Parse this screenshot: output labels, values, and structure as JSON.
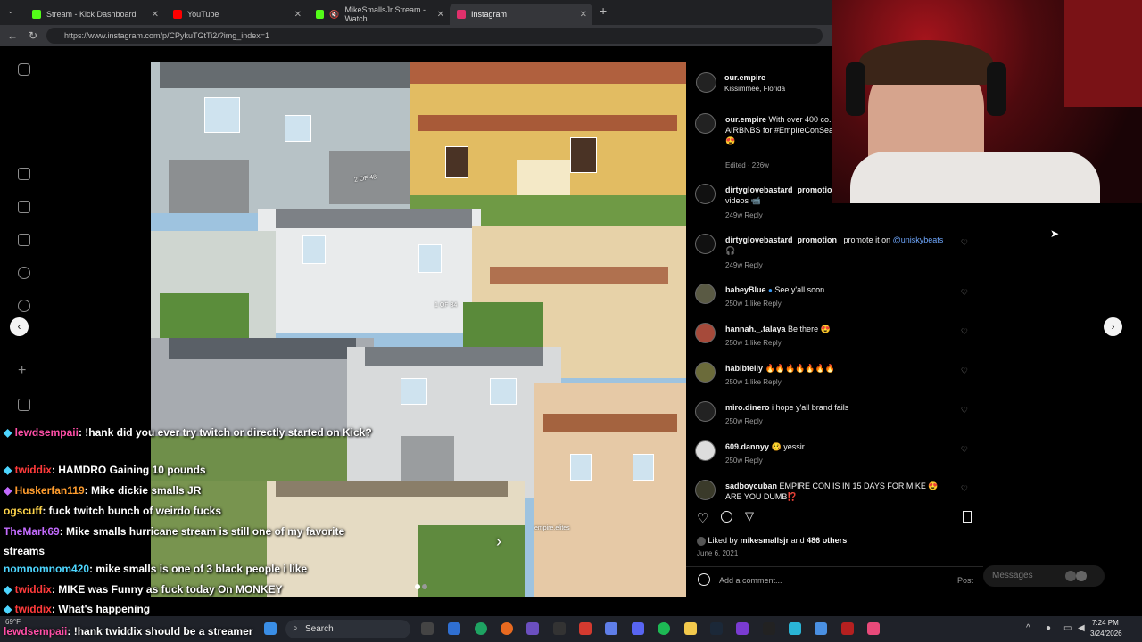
{
  "browser": {
    "tabs": [
      {
        "label": "Stream - Kick Dashboard",
        "color": "#53fc18"
      },
      {
        "label": "YouTube",
        "color": "#ff0000"
      },
      {
        "label": "MikeSmallsJr Stream - Watch",
        "color": "#53fc18"
      },
      {
        "label": "Instagram",
        "color": "#e1306c"
      }
    ],
    "url": "https://www.instagram.com/p/CPykuTGtTi2/?img_index=1"
  },
  "post": {
    "image_labels": {
      "a": "2 OF 48",
      "b": "1 OF 34",
      "c": "empire.elites"
    },
    "author": "our.empire",
    "location": "Kissimmee, Florida",
    "caption": {
      "user": "our.empire",
      "text": "With over 400 co... counting...the Our.Empire co... AIRBNBS for #EmpireConSea... showtime! Who's excited?! 😍",
      "meta": "Edited · 226w"
    },
    "comments": [
      {
        "user": "dirtyglovebastard_promotion",
        "text": "videos 📹",
        "meta": "249w   Reply"
      },
      {
        "user": "dirtyglovebastard_promotion_",
        "text": "promote it on",
        "link": "@uniskybeats",
        "extra": "🎧",
        "meta": "249w   Reply"
      },
      {
        "user": "babeyBlue",
        "text": "See y'all soon",
        "meta": "250w   1 like   Reply"
      },
      {
        "user": "hannah._.talaya",
        "text": "Be there 😍",
        "meta": "250w   1 like   Reply"
      },
      {
        "user": "habibtelly",
        "text": "🔥🔥🔥🔥🔥🔥🔥",
        "meta": "250w   1 like   Reply"
      },
      {
        "user": "miro.dinero",
        "text": "i hope y'all brand fails",
        "meta": "250w   Reply"
      },
      {
        "user": "609.dannyy",
        "text": "🥴 yessir",
        "meta": "250w   Reply"
      },
      {
        "user": "sadboycuban",
        "text": "EMPIRE CON IS IN 15 DAYS FOR MIKE 😍 ARE YOU DUMB⁉️",
        "meta": ""
      }
    ],
    "likes": {
      "prefix": "Liked by",
      "user": "mikesmallsjr",
      "and": "and",
      "count": "486 others"
    },
    "date": "June 6, 2021",
    "add_comment_placeholder": "Add a comment...",
    "post_label": "Post"
  },
  "messages_label": "Messages",
  "chat": [
    {
      "user": "lewdsempaii",
      "color": "#ff4fa7",
      "msg": ": !hank did you ever try twitch or directly started on Kick?"
    },
    {
      "user": "twiddix",
      "color": "#ff3b3b",
      "msg": ": HAMDRO Gaining 10 pounds"
    },
    {
      "user": "Huskerfan119",
      "color": "#ff9d2e",
      "msg": ": Mike dickie smalls JR"
    },
    {
      "user": "ogscuff",
      "color": "#ffd54a",
      "msg": ": fuck twitch bunch of weirdo fucks"
    },
    {
      "user": "TheMark69",
      "color": "#c46bff",
      "msg": ": Mike smalls hurricane stream is still one of my favorite streams"
    },
    {
      "user": "nomnomnom420",
      "color": "#4dd6ff",
      "msg": ": mike smalls is one of 3 black people i like"
    },
    {
      "user": "twiddix",
      "color": "#ff3b3b",
      "msg": ": MIKE was Funny as fuck today On MONKEY"
    },
    {
      "user": "twiddix",
      "color": "#ff3b3b",
      "msg": ": What's happening"
    },
    {
      "user": "lewdsempaii",
      "color": "#ff4fa7",
      "msg": ": !hank twiddix should be a streamer"
    }
  ],
  "taskbar": {
    "weather": "69°F",
    "search": "Search",
    "time": "7:24 PM",
    "date": "3/24/2026"
  }
}
